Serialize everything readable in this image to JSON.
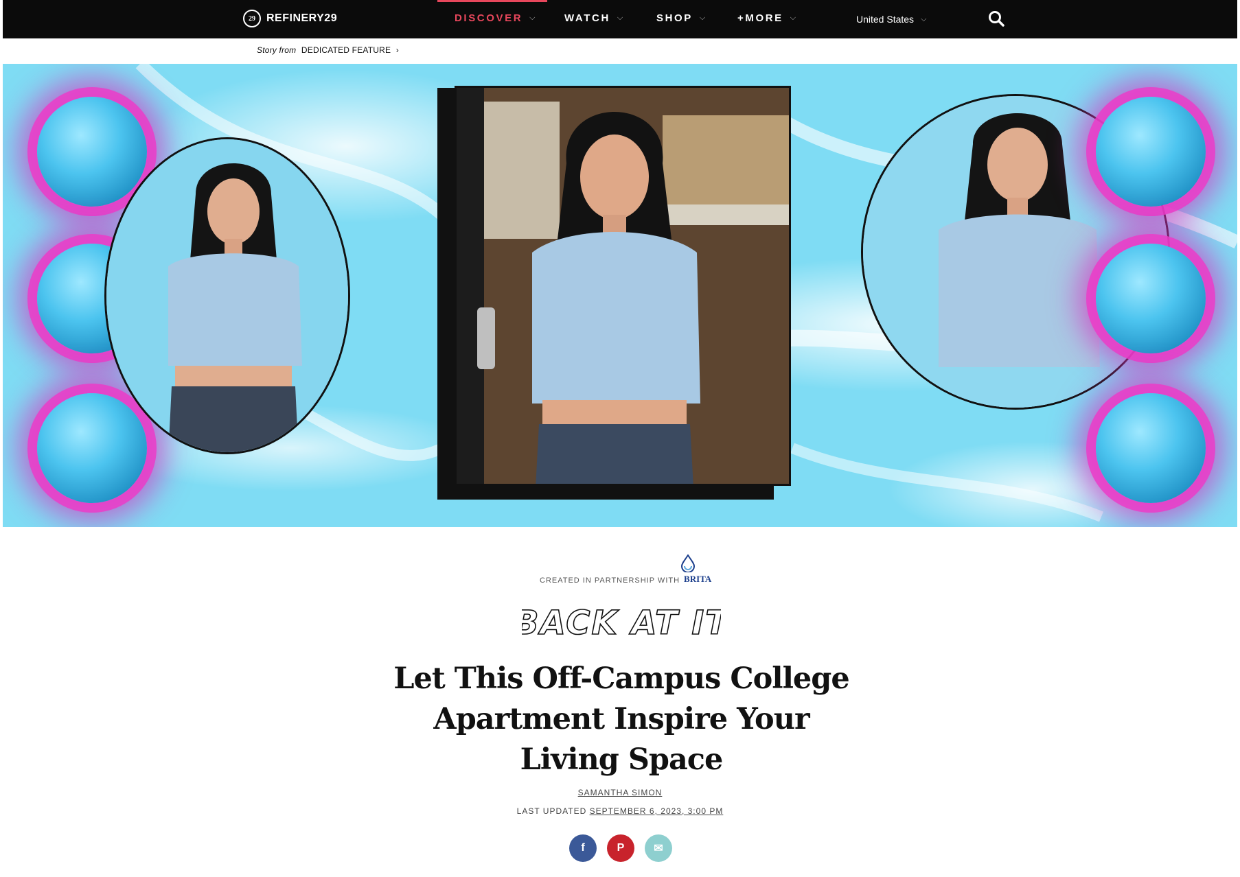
{
  "nav": {
    "logo_text": "REFINERY29",
    "logo_mark": "29",
    "items": [
      {
        "label": "DISCOVER",
        "active": true
      },
      {
        "label": "WATCH",
        "active": false
      },
      {
        "label": "SHOP",
        "active": false
      },
      {
        "label": "+MORE",
        "active": false
      }
    ],
    "country": "United States",
    "chevron": "⌵",
    "accent_color": "#e8475c"
  },
  "story": {
    "prefix": "Story from",
    "section": "DEDICATED FEATURE",
    "arrow": "›"
  },
  "article": {
    "partner_prefix": "CREATED IN PARTNERSHIP WITH",
    "partner_brand": "BRITA",
    "series_title": "BACK AT IT",
    "headline": "Let This Off-Campus College Apartment Inspire Your Living Space",
    "author": "SAMANTHA SIMON",
    "updated_label": "LAST UPDATED",
    "updated_date": "SEPTEMBER 6, 2023, 3:00 PM"
  },
  "share": [
    {
      "name": "facebook",
      "glyph": "f",
      "color": "#3b5998"
    },
    {
      "name": "pinterest",
      "glyph": "P",
      "color": "#c8232c"
    },
    {
      "name": "email",
      "glyph": "✉",
      "color": "#8ecfcf"
    }
  ],
  "icons": {
    "search": "search-icon",
    "logo": "refinery29-logo-icon",
    "brita_drop": "brita-drop-icon"
  }
}
